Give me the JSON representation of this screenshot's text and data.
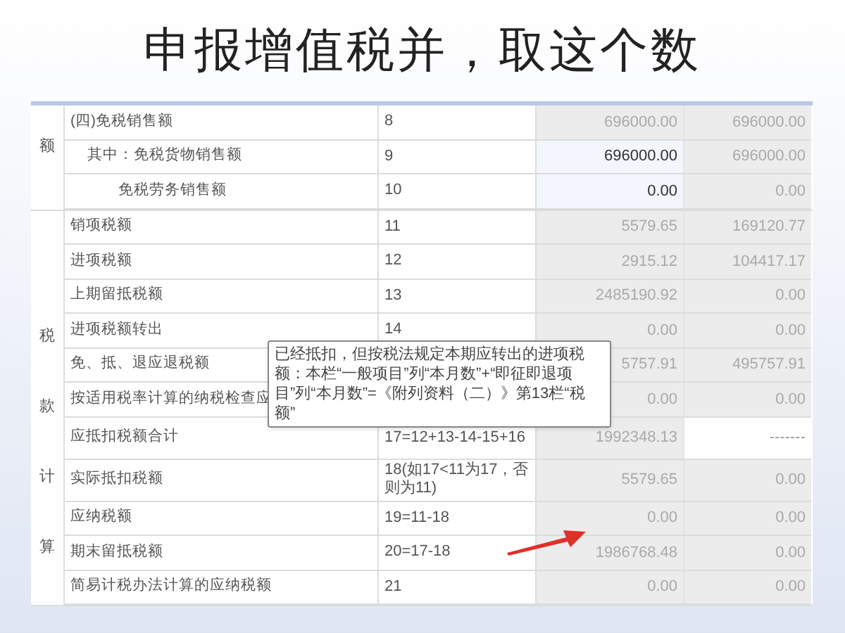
{
  "title": "申报增值税并，取这个数",
  "table": {
    "groups": [
      {
        "label": "额",
        "rows": [
          {
            "item": "(四)免税销售额",
            "line": "8",
            "cells": [
              {
                "text": "696000.00",
                "editable": false
              },
              {
                "text": "696000.00",
                "editable": false
              }
            ],
            "children": [
              {
                "item": "其中：免税货物销售额",
                "line": "9",
                "cells": [
                  {
                    "text": "696000.00",
                    "editable": true
                  },
                  {
                    "text": "696000.00",
                    "editable": false
                  }
                ],
                "children": [
                  {
                    "item": "免税劳务销售额",
                    "line": "10",
                    "cells": [
                      {
                        "text": "0.00",
                        "editable": true
                      },
                      {
                        "text": "0.00",
                        "editable": false
                      }
                    ]
                  }
                ]
              }
            ]
          }
        ]
      },
      {
        "label": "税款计算",
        "rows": [
          {
            "item": "销项税额",
            "line": "11",
            "cells": [
              {
                "text": "5579.65",
                "editable": false
              },
              {
                "text": "169120.77",
                "editable": false
              }
            ]
          },
          {
            "item": "进项税额",
            "line": "12",
            "cells": [
              {
                "text": "2915.12",
                "editable": false
              },
              {
                "text": "104417.17",
                "editable": false
              }
            ]
          },
          {
            "item": "上期留抵税额",
            "line": "13",
            "cells": [
              {
                "text": "2485190.92",
                "editable": false
              },
              {
                "text": "0.00",
                "editable": false
              }
            ]
          },
          {
            "item": "进项税额转出",
            "line": "14",
            "cells": [
              {
                "text": "0.00",
                "editable": false
              },
              {
                "text": "0.00",
                "editable": false
              }
            ]
          },
          {
            "item": "免、抵、退应退税额",
            "cells": [
              {
                "text": "5757.91",
                "editable": false
              },
              {
                "text": "495757.91",
                "editable": false
              }
            ]
          },
          {
            "item": "按适用税率计算的纳税检查应",
            "cells": [
              {
                "text": "0.00",
                "editable": false
              },
              {
                "text": "0.00",
                "editable": false
              }
            ]
          },
          {
            "item": "应抵扣税额合计",
            "line": "17=12+13-14-15+16",
            "cells": [
              {
                "text": "1992348.13",
                "editable": false
              },
              {
                "text": "-------",
                "editable": true
              }
            ]
          },
          {
            "item": "实际抵扣税额",
            "line": "18(如17<11为17，否则为11)",
            "cells": [
              {
                "text": "5579.65",
                "editable": false
              },
              {
                "text": "0.00",
                "editable": false
              }
            ]
          },
          {
            "item": "应纳税额",
            "line": "19=11-18",
            "cells": [
              {
                "text": "0.00",
                "editable": false
              },
              {
                "text": "0.00",
                "editable": false
              }
            ]
          },
          {
            "item": "期末留抵税额",
            "line": "20=17-18",
            "cells": [
              {
                "text": "1986768.48",
                "editable": false
              },
              {
                "text": "0.00",
                "editable": false
              }
            ]
          },
          {
            "item": "简易计税办法计算的应纳税额",
            "line": "21",
            "cells": [
              {
                "text": "0.00",
                "editable": false
              },
              {
                "text": "0.00",
                "editable": false
              }
            ]
          }
        ]
      }
    ]
  },
  "tooltip": "已经抵扣，但按税法规定本期应转出的进项税额：本栏“一般项目”列“本月数”+“即征即退项目”列“本月数”=《附列资料（二）》第13栏“税额”"
}
